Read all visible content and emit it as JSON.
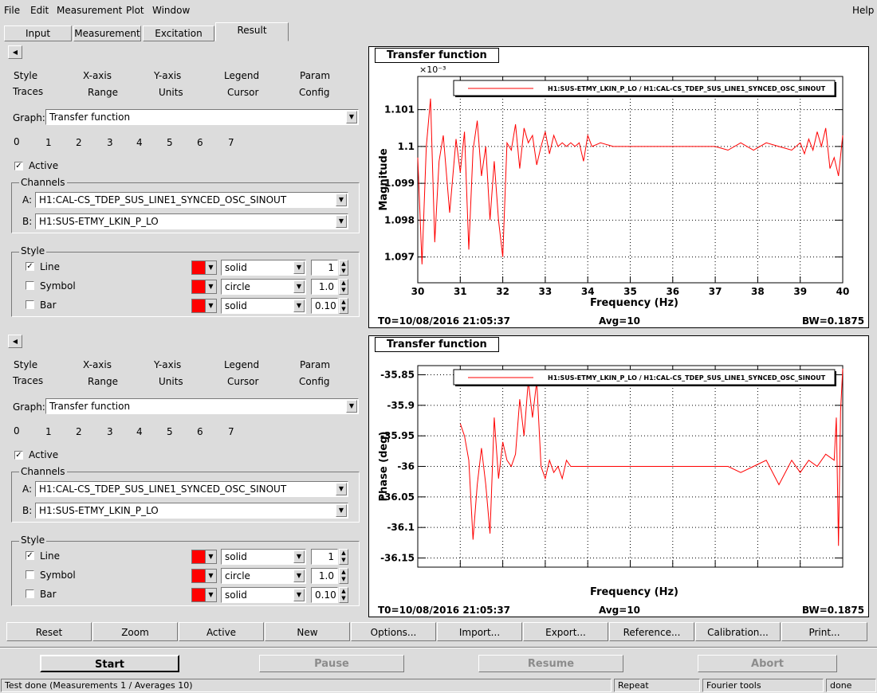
{
  "menu": [
    "File",
    "Edit",
    "Measurement",
    "Plot",
    "Window"
  ],
  "menu_help": "Help",
  "main_tabs": [
    "Input",
    "Measurement",
    "Excitation",
    "Result"
  ],
  "panels": [
    {
      "tabs_row1": [
        "Style",
        "X-axis",
        "Y-axis",
        "Legend",
        "Param"
      ],
      "tabs_row2": [
        "Traces",
        "Range",
        "Units",
        "Cursor",
        "Config"
      ],
      "graph_label": "Graph:",
      "graph_value": "Transfer function",
      "trace_tabs": [
        "0",
        "1",
        "2",
        "3",
        "4",
        "5",
        "6",
        "7"
      ],
      "active_label": "Active",
      "channels_label": "Channels",
      "channel_a_label": "A:",
      "channel_a": "H1:CAL-CS_TDEP_SUS_LINE1_SYNCED_OSC_SINOUT",
      "channel_b_label": "B:",
      "channel_b": "H1:SUS-ETMY_LKIN_P_LO",
      "style_label": "Style",
      "style_rows": [
        {
          "label": "Line",
          "checked": true,
          "type": "solid",
          "value": "1"
        },
        {
          "label": "Symbol",
          "checked": false,
          "type": "circle",
          "value": "1.0"
        },
        {
          "label": "Bar",
          "checked": false,
          "type": "solid",
          "value": "0.10"
        }
      ]
    },
    {
      "tabs_row1": [
        "Style",
        "X-axis",
        "Y-axis",
        "Legend",
        "Param"
      ],
      "tabs_row2": [
        "Traces",
        "Range",
        "Units",
        "Cursor",
        "Config"
      ],
      "graph_label": "Graph:",
      "graph_value": "Transfer function",
      "trace_tabs": [
        "0",
        "1",
        "2",
        "3",
        "4",
        "5",
        "6",
        "7"
      ],
      "active_label": "Active",
      "channels_label": "Channels",
      "channel_a_label": "A:",
      "channel_a": "H1:CAL-CS_TDEP_SUS_LINE1_SYNCED_OSC_SINOUT",
      "channel_b_label": "B:",
      "channel_b": "H1:SUS-ETMY_LKIN_P_LO",
      "style_label": "Style",
      "style_rows": [
        {
          "label": "Line",
          "checked": true,
          "type": "solid",
          "value": "1"
        },
        {
          "label": "Symbol",
          "checked": false,
          "type": "circle",
          "value": "1.0"
        },
        {
          "label": "Bar",
          "checked": false,
          "type": "solid",
          "value": "0.10"
        }
      ]
    }
  ],
  "chart_data": [
    {
      "type": "line",
      "title": "Transfer function",
      "xlabel": "Frequency (Hz)",
      "ylabel": "Magnitude",
      "exponent_label": "×10⁻³",
      "xlim": [
        30,
        40
      ],
      "ylim": [
        1.0963,
        1.1019
      ],
      "x_ticks": [
        "30",
        "31",
        "32",
        "33",
        "34",
        "35",
        "36",
        "37",
        "38",
        "39",
        "40"
      ],
      "y_ticks": [
        "1.097",
        "1.098",
        "1.099",
        "1.1",
        "1.101"
      ],
      "y_tick_values": [
        1.097,
        1.098,
        1.099,
        1.1,
        1.101
      ],
      "legend": "H1:SUS-ETMY_LKIN_P_LO / H1:CAL-CS_TDEP_SUS_LINE1_SYNCED_OSC_SINOUT",
      "line_color": "#ff0000",
      "footer": {
        "t0": "T0=10/08/2016 21:05:37",
        "avg": "Avg=10",
        "bw": "BW=0.1875"
      },
      "x": [
        30.0,
        30.1,
        30.2,
        30.3,
        30.4,
        30.5,
        30.6,
        30.75,
        30.9,
        31.0,
        31.1,
        31.2,
        31.3,
        31.4,
        31.5,
        31.6,
        31.7,
        31.8,
        31.9,
        32.0,
        32.1,
        32.2,
        32.3,
        32.4,
        32.5,
        32.6,
        32.7,
        32.8,
        32.9,
        33.0,
        33.1,
        33.2,
        33.3,
        33.4,
        33.5,
        33.6,
        33.7,
        33.8,
        33.9,
        34.0,
        34.1,
        34.3,
        34.6,
        35.0,
        35.5,
        36.0,
        36.5,
        37.0,
        37.3,
        37.6,
        37.9,
        38.2,
        38.5,
        38.8,
        39.0,
        39.1,
        39.2,
        39.3,
        39.4,
        39.5,
        39.6,
        39.7,
        39.8,
        39.9,
        40.0
      ],
      "y": [
        1.0997,
        1.0968,
        1.1,
        1.1013,
        1.0974,
        1.0996,
        1.1003,
        1.0982,
        1.1002,
        1.0993,
        1.1004,
        1.0972,
        1.0999,
        1.1007,
        1.0992,
        1.1,
        1.098,
        1.0996,
        1.098,
        1.097,
        1.1001,
        1.0999,
        1.1006,
        1.0994,
        1.1005,
        1.1001,
        1.1003,
        1.0995,
        1.1,
        1.1004,
        1.0998,
        1.1003,
        1.1,
        1.1001,
        1.1,
        1.1001,
        1.1,
        1.1001,
        1.0996,
        1.1003,
        1.1,
        1.1001,
        1.1,
        1.1,
        1.1,
        1.1,
        1.1,
        1.1,
        1.0999,
        1.1001,
        1.0999,
        1.1001,
        1.1,
        1.0999,
        1.1001,
        1.0998,
        1.1002,
        1.0999,
        1.1004,
        1.1,
        1.1005,
        1.0994,
        1.0997,
        1.0992,
        1.1003
      ]
    },
    {
      "type": "line",
      "title": "Transfer function",
      "xlabel": "Frequency (Hz)",
      "ylabel": "Phase (deg)",
      "xlim": [
        30,
        40
      ],
      "ylim": [
        -36.165,
        -35.835
      ],
      "x_ticks": [],
      "y_ticks": [
        "-35.85",
        "-35.9",
        "-35.95",
        "-36",
        "-36.05",
        "-36.1",
        "-36.15"
      ],
      "y_tick_values": [
        -35.85,
        -35.9,
        -35.95,
        -36.0,
        -36.05,
        -36.1,
        -36.15
      ],
      "legend": "H1:SUS-ETMY_LKIN_P_LO / H1:CAL-CS_TDEP_SUS_LINE1_SYNCED_OSC_SINOUT",
      "line_color": "#ff0000",
      "footer": {
        "t0": "T0=10/08/2016 21:05:37",
        "avg": "Avg=10",
        "bw": "BW=0.1875"
      },
      "x": [
        31.0,
        31.1,
        31.2,
        31.3,
        31.4,
        31.5,
        31.6,
        31.7,
        31.8,
        31.9,
        32.0,
        32.1,
        32.2,
        32.3,
        32.4,
        32.5,
        32.6,
        32.7,
        32.8,
        32.9,
        33.0,
        33.1,
        33.2,
        33.3,
        33.4,
        33.5,
        33.6,
        33.8,
        34.0,
        34.2,
        34.5,
        35.0,
        35.5,
        36.0,
        36.5,
        37.0,
        37.3,
        37.6,
        37.9,
        38.2,
        38.5,
        38.8,
        39.0,
        39.2,
        39.4,
        39.6,
        39.8,
        39.85,
        39.9,
        39.95,
        40.0
      ],
      "y": [
        -35.93,
        -35.95,
        -35.99,
        -36.12,
        -36.03,
        -35.97,
        -36.03,
        -36.11,
        -35.92,
        -36.02,
        -35.96,
        -35.99,
        -36.0,
        -35.98,
        -35.89,
        -35.95,
        -35.86,
        -35.92,
        -35.86,
        -36.0,
        -36.02,
        -35.99,
        -36.01,
        -36.0,
        -36.02,
        -35.99,
        -36.0,
        -36.0,
        -36.0,
        -36.0,
        -36.0,
        -36.0,
        -36.0,
        -36.0,
        -36.0,
        -36.0,
        -36.0,
        -36.01,
        -36.0,
        -35.99,
        -36.03,
        -35.99,
        -36.01,
        -35.99,
        -36.0,
        -35.98,
        -35.99,
        -35.92,
        -36.13,
        -35.91,
        -35.84
      ]
    }
  ],
  "bottom_buttons": [
    "Reset",
    "Zoom",
    "Active",
    "New",
    "Options...",
    "Import...",
    "Export...",
    "Reference...",
    "Calibration...",
    "Print..."
  ],
  "big_buttons": [
    "Start",
    "Pause",
    "Resume",
    "Abort"
  ],
  "status": {
    "message": "Test done (Measurements 1 / Averages 10)",
    "repeat": "Repeat",
    "tools": "Fourier tools",
    "state": "done"
  }
}
